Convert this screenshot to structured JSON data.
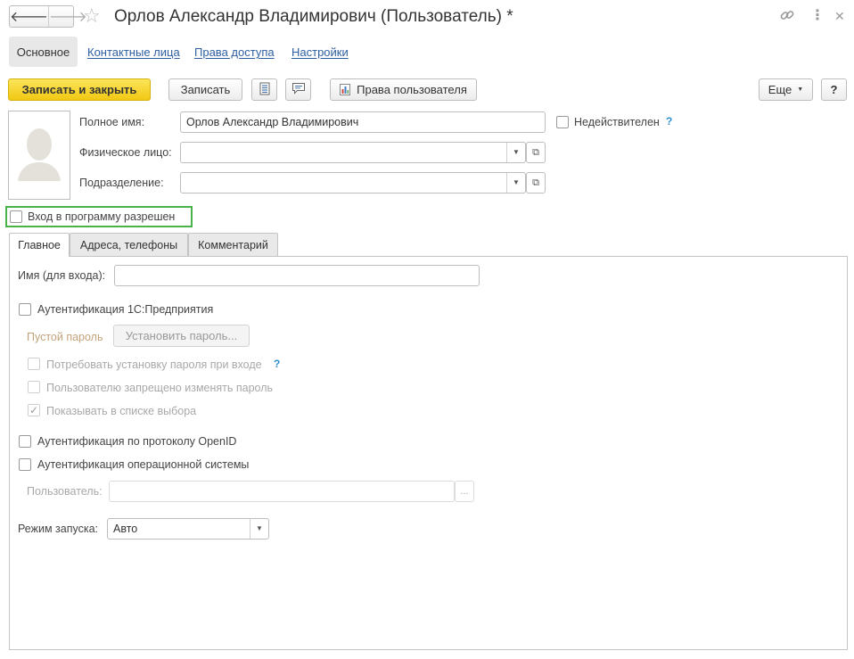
{
  "window": {
    "title": "Орлов Александр Владимирович (Пользователь) *",
    "back_icon": "arrow-left-icon",
    "forward_icon": "arrow-right-icon",
    "favorite_icon": "star-icon",
    "link_icon": "link-icon",
    "more_icon": "kebab-icon",
    "close_icon": "close-icon",
    "glyphs": {
      "back": "🡐",
      "forward": "🡒",
      "star": "☆",
      "link": "🔗",
      "more": "⋮",
      "close": "✕"
    }
  },
  "sections": {
    "active": "Основное",
    "links": [
      "Контактные лица",
      "Права доступа",
      "Настройки"
    ]
  },
  "toolbar": {
    "save_close": "Записать и закрыть",
    "save": "Записать",
    "rights": "Права пользователя",
    "more": "Еще",
    "help": "?"
  },
  "form": {
    "full_name_label": "Полное имя:",
    "full_name_value": "Орлов Александр Владимирович",
    "invalid_label": "Недействителен",
    "invalid_help": "?",
    "person_label": "Физическое лицо:",
    "person_value": "",
    "dept_label": "Подразделение:",
    "dept_value": "",
    "login_allowed_label": "Вход в программу разрешен"
  },
  "tabs": [
    "Главное",
    "Адреса, телефоны",
    "Комментарий"
  ],
  "main_tab": {
    "login_name_label": "Имя (для входа):",
    "login_name_value": "",
    "auth_1c_label": "Аутентификация 1С:Предприятия",
    "empty_password": "Пустой пароль",
    "set_password": "Установить пароль...",
    "require_password_change": "Потребовать установку пароля при входе",
    "require_help": "?",
    "forbid_change": "Пользователю запрещено изменять пароль",
    "show_in_list": "Показывать в списке выбора",
    "auth_openid": "Аутентификация по протоколу OpenID",
    "auth_os": "Аутентификация операционной системы",
    "os_user_label": "Пользователь:",
    "os_user_value": "",
    "os_user_btn": "...",
    "launch_mode_label": "Режим запуска:",
    "launch_mode_value": "Авто"
  },
  "colors": {
    "primary_button": "#f5d228",
    "link": "#2d5fa0",
    "highlight_border": "#49b249",
    "help_mark": "#2f8fd0"
  }
}
